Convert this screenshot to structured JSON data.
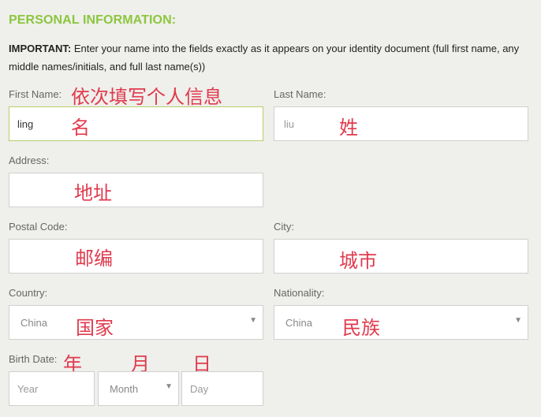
{
  "section_title": "PERSONAL INFORMATION:",
  "notice": {
    "bold": "IMPORTANT:",
    "text": " Enter your name into the fields exactly as it appears on your identity document (full first name, any middle names/initials, and full last name(s))"
  },
  "fields": {
    "first_name": {
      "label": "First Name:",
      "value": "ling"
    },
    "last_name": {
      "label": "Last Name:",
      "placeholder": "liu"
    },
    "address": {
      "label": "Address:",
      "value": ""
    },
    "postal_code": {
      "label": "Postal Code:",
      "value": ""
    },
    "city": {
      "label": "City:",
      "value": ""
    },
    "country": {
      "label": "Country:",
      "selected": "China"
    },
    "nationality": {
      "label": "Nationality:",
      "selected": "China"
    },
    "birth_date": {
      "label": "Birth Date:",
      "year_placeholder": "Year",
      "month_selected": "Month",
      "day_placeholder": "Day"
    }
  },
  "annotations": {
    "fill_in_order": "依次填写个人信息",
    "first_name": "名",
    "last_name": "姓",
    "address": "地址",
    "postal_code": "邮编",
    "city": "城市",
    "country": "国家",
    "nationality": "民族",
    "year": "年",
    "month": "月",
    "day": "日"
  },
  "icons": {
    "caret": "▼"
  },
  "colors": {
    "title_green": "#8cc63f",
    "annotation_red": "#e03a4e",
    "background": "#efefeb"
  }
}
